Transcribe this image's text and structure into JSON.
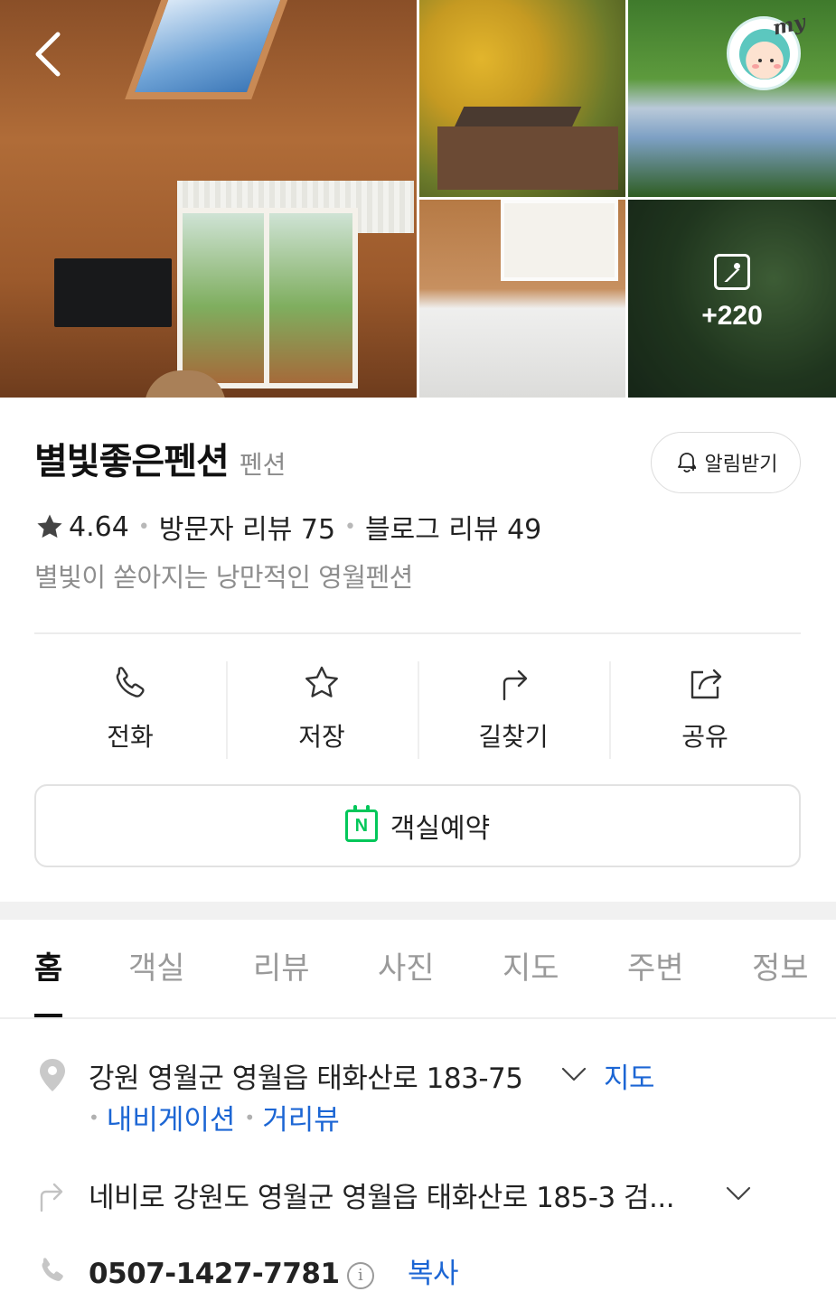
{
  "gallery": {
    "more_count": "+220",
    "my_label": "my"
  },
  "place": {
    "name": "별빛좋은펜션",
    "category": "펜션",
    "notify_label": "알림받기",
    "rating": "4.64",
    "visitor_reviews": "방문자 리뷰 75",
    "blog_reviews": "블로그 리뷰 49",
    "description": "별빛이 쏟아지는 낭만적인 영월펜션"
  },
  "actions": [
    {
      "label": "전화",
      "icon": "phone-icon"
    },
    {
      "label": "저장",
      "icon": "star-outline-icon"
    },
    {
      "label": "길찾기",
      "icon": "directions-icon"
    },
    {
      "label": "공유",
      "icon": "share-icon"
    }
  ],
  "reserve": {
    "label": "객실예약",
    "icon_text": "N"
  },
  "tabs": [
    "홈",
    "객실",
    "리뷰",
    "사진",
    "지도",
    "주변",
    "정보"
  ],
  "active_tab": "홈",
  "info": {
    "address": "강원 영월군 영월읍 태화산로 183-75",
    "map_link": "지도",
    "navigation_link": "내비게이션",
    "street_view_link": "거리뷰",
    "directions_text": "네비로 강원도 영월군 영월읍 태화산로 185-3 검...",
    "phone": "0507-1427-7781",
    "info_symbol": "i",
    "copy_label": "복사"
  },
  "colors": {
    "link": "#1c66d4",
    "naver_green": "#03c75a",
    "muted": "#8e8e8e"
  }
}
